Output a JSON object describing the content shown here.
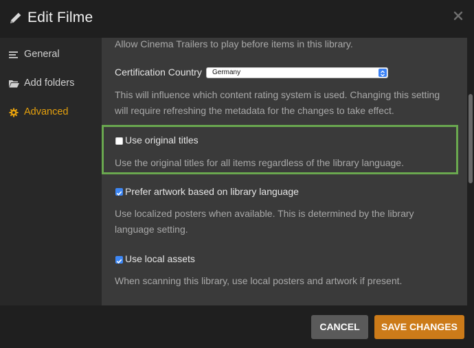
{
  "header": {
    "title": "Edit Filme"
  },
  "sidebar": {
    "items": [
      {
        "label": "General",
        "icon": "list-icon",
        "active": false
      },
      {
        "label": "Add folders",
        "icon": "folder-icon",
        "active": false
      },
      {
        "label": "Advanced",
        "icon": "gear-icon",
        "active": true
      }
    ]
  },
  "settings": {
    "cinema_trailers_desc": "Allow Cinema Trailers to play before items in this library.",
    "certification": {
      "label": "Certification Country",
      "value": "Germany",
      "desc_line1": "This will influence which content rating system is used. Changing this setting",
      "desc_line2": "will require refreshing the metadata for the changes to take effect."
    },
    "original_titles": {
      "label": "Use original titles",
      "checked": false,
      "desc": "Use the original titles for all items regardless of the library language."
    },
    "prefer_artwork": {
      "label": "Prefer artwork based on library language",
      "checked": true,
      "desc_line1": "Use localized posters when available. This is determined by the library",
      "desc_line2": "language setting."
    },
    "local_assets": {
      "label": "Use local assets",
      "checked": true,
      "desc": "When scanning this library, use local posters and artwork if present."
    }
  },
  "footer": {
    "cancel_label": "CANCEL",
    "save_label": "SAVE CHANGES"
  },
  "colors": {
    "accent": "#e5a00d",
    "save_button": "#cc7b19",
    "highlight_border": "#6aa84f",
    "checkbox_on": "#3d87f5"
  }
}
